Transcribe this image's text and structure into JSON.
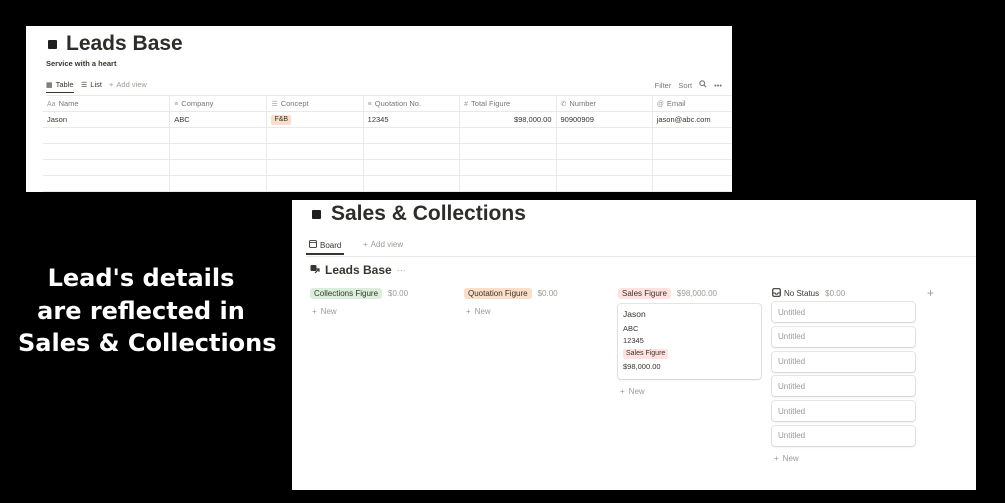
{
  "leads_base": {
    "title": "Leads Base",
    "subtitle": "Service with a heart",
    "views": [
      {
        "label": "Table",
        "icon": "table-icon"
      },
      {
        "label": "List",
        "icon": "list-icon"
      },
      {
        "label": "Add view",
        "icon": "plus-icon"
      }
    ],
    "toolbar": {
      "filter": "Filter",
      "sort": "Sort",
      "search_icon": "search-icon",
      "more_icon": "more-icon"
    },
    "columns": [
      {
        "label": "Name",
        "icon": "text-icon"
      },
      {
        "label": "Company",
        "icon": "text-lines-icon"
      },
      {
        "label": "Concept",
        "icon": "list-icon"
      },
      {
        "label": "Quotation No.",
        "icon": "text-lines-icon"
      },
      {
        "label": "Total Figure",
        "icon": "hash-icon"
      },
      {
        "label": "Number",
        "icon": "phone-icon"
      },
      {
        "label": "Email",
        "icon": "at-icon"
      }
    ],
    "rows": [
      {
        "name": "Jason",
        "company": "ABC",
        "concept": "F&B",
        "quotation": "12345",
        "total": "$98,000.00",
        "number": "90900909",
        "email": "jason@abc.com"
      }
    ],
    "concept_color": "#fadec9"
  },
  "caption": {
    "line1": "Lead's details",
    "line2": "are reflected in",
    "line3": "Sales & Collections"
  },
  "sales_collections": {
    "title": "Sales & Collections",
    "view": {
      "label": "Board",
      "icon": "board-icon"
    },
    "add_view": "Add view",
    "group_title": "Leads Base",
    "group_more": "···",
    "columns": [
      {
        "label": "Collections Figure",
        "sum": "$0.00",
        "color": "#dbeddb"
      },
      {
        "label": "Quotation Figure",
        "sum": "$0.00",
        "color": "#fadec9"
      },
      {
        "label": "Sales Figure",
        "sum": "$98,000.00",
        "color": "#ffe2dd"
      },
      {
        "label": "No Status",
        "sum": "$0.00",
        "icon": "inbox-icon"
      }
    ],
    "card": {
      "title": "Jason",
      "company": "ABC",
      "quotation": "12345",
      "tag": "Sales Figure",
      "total": "$98,000.00"
    },
    "untitled": [
      "Untitled",
      "Untitled",
      "Untitled",
      "Untitled",
      "Untitled",
      "Untitled"
    ],
    "new_label": "New",
    "add_group": "+"
  }
}
